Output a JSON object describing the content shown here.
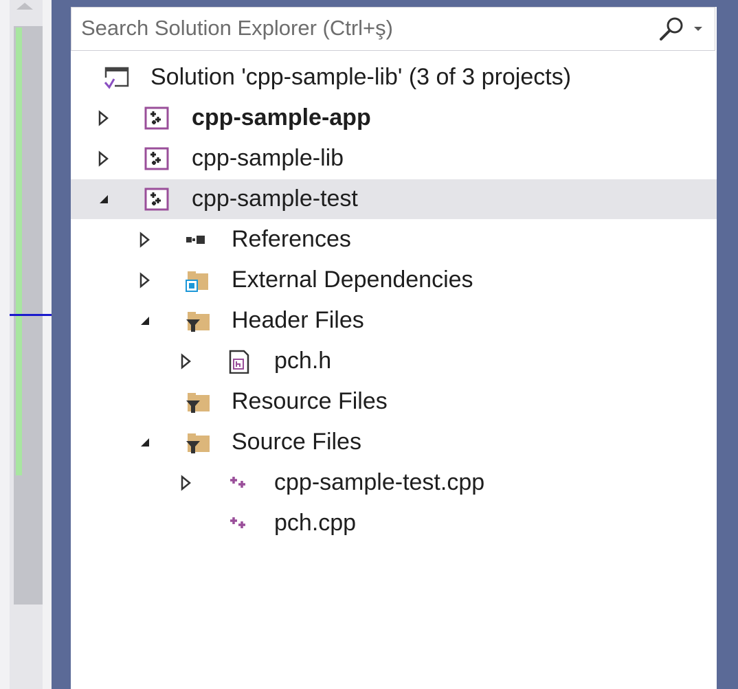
{
  "search": {
    "placeholder": "Search Solution Explorer (Ctrl+ş)"
  },
  "tree": {
    "solution": "Solution 'cpp-sample-lib' (3 of 3 projects)",
    "items": [
      {
        "label": "cpp-sample-app",
        "icon": "cpp-project-icon",
        "expander": "collapsed",
        "bold": true
      },
      {
        "label": "cpp-sample-lib",
        "icon": "cpp-project-icon",
        "expander": "collapsed"
      },
      {
        "label": "cpp-sample-test",
        "icon": "cpp-project-icon",
        "expander": "expanded",
        "selected": true
      },
      {
        "label": "References",
        "icon": "references-icon",
        "expander": "collapsed"
      },
      {
        "label": "External Dependencies",
        "icon": "external-dependencies-icon",
        "expander": "collapsed"
      },
      {
        "label": "Header Files",
        "icon": "filter-folder-icon",
        "expander": "expanded"
      },
      {
        "label": "pch.h",
        "icon": "header-file-icon",
        "expander": "collapsed"
      },
      {
        "label": "Resource Files",
        "icon": "filter-folder-icon",
        "expander": "none"
      },
      {
        "label": "Source Files",
        "icon": "filter-folder-icon",
        "expander": "expanded"
      },
      {
        "label": "cpp-sample-test.cpp",
        "icon": "cpp-file-icon",
        "expander": "collapsed"
      },
      {
        "label": "pch.cpp",
        "icon": "cpp-file-icon",
        "expander": "none"
      }
    ]
  },
  "colors": {
    "frame": "#5b6a97",
    "selection": "#e4e4e8",
    "project_icon": "#9a4f9a",
    "filter_folder": "#dcb67a"
  }
}
